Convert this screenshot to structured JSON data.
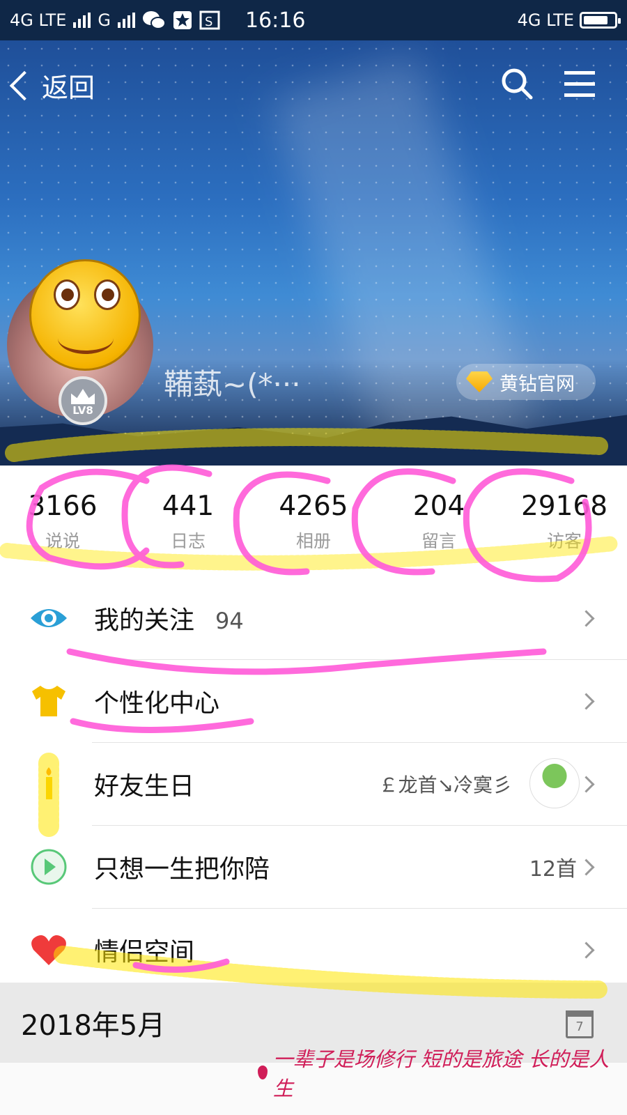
{
  "status_bar": {
    "network_left": "4G LTE",
    "network_g": "G",
    "time": "16:16",
    "network_right": "4G LTE",
    "icons": [
      "signal-icon",
      "wechat-icon",
      "star-app-icon",
      "s-app-icon",
      "battery-icon"
    ]
  },
  "header": {
    "back_label": "返回",
    "search_icon": "search-icon",
    "menu_icon": "menu-icon"
  },
  "profile": {
    "nickname": "鞴蓺~(*···",
    "level_badge": "LV8",
    "vip_label": "黄钻官网"
  },
  "stats": [
    {
      "value": "3166",
      "label": "说说"
    },
    {
      "value": "441",
      "label": "日志"
    },
    {
      "value": "4265",
      "label": "相册"
    },
    {
      "value": "204",
      "label": "留言"
    },
    {
      "value": "29168",
      "label": "访客"
    }
  ],
  "menu": {
    "following": {
      "label": "我的关注",
      "count": "94"
    },
    "personalize": {
      "label": "个性化中心"
    },
    "birthday": {
      "label": "好友生日",
      "friend": "￡龙首↘冷寞彡"
    },
    "music": {
      "label": "只想一生把你陪",
      "count": "12首"
    },
    "couple": {
      "label": "情侣空间"
    }
  },
  "timeline": {
    "date": "2018年5月",
    "calendar_day": "7"
  },
  "footer_motto": "一辈子是场修行 短的是旅途 长的是人生",
  "colors": {
    "accent_blue": "#2a9fd6",
    "vip_gold": "#f5b300",
    "heart_red": "#ef3b3b",
    "highlight_pink": "#ff5ad8",
    "highlight_yellow": "#ffe600"
  }
}
